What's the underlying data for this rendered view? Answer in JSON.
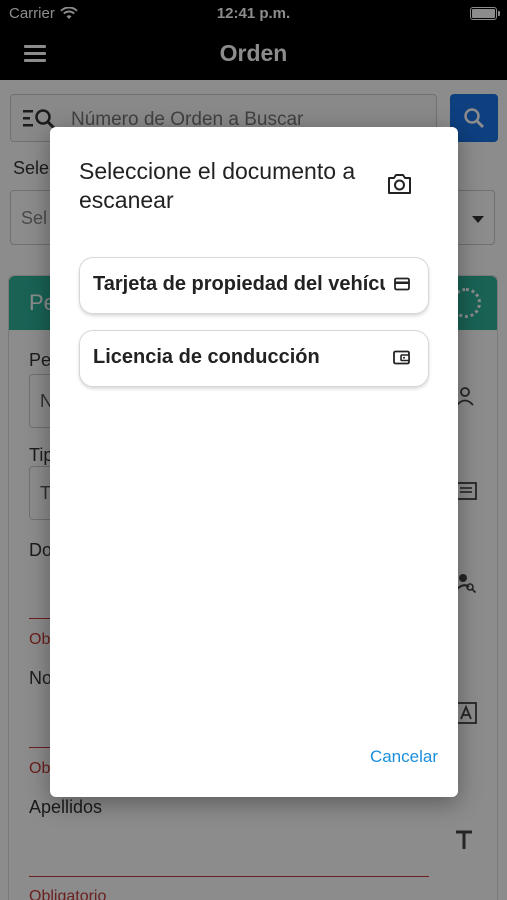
{
  "status_bar": {
    "carrier": "Carrier",
    "time": "12:41 p.m."
  },
  "app_bar": {
    "title": "Orden"
  },
  "search": {
    "placeholder": "Número de Orden a Buscar"
  },
  "background": {
    "select_label": "Sele",
    "select_value": "Sel",
    "card_title": "Pe",
    "field1_label": "Pe",
    "field1_value": "N",
    "field2_label": "Tip",
    "field2_value": "T",
    "field3_label": "Do",
    "required1": "Obl",
    "field4_label": "No",
    "required2": "Ob",
    "apellidos_label": "Apellidos",
    "required3": "Obligatorio"
  },
  "dialog": {
    "title": "Seleccione el documento a escanear",
    "options": [
      {
        "label": "Tarjeta de propiedad del vehículo",
        "icon": "card-icon"
      },
      {
        "label": "Licencia de conducción",
        "icon": "wallet-icon"
      }
    ],
    "cancel_label": "Cancelar"
  },
  "colors": {
    "accent": "#1a73e8",
    "link": "#1a8fdd",
    "card_header": "#2fb39a",
    "error": "#c43a3a"
  }
}
